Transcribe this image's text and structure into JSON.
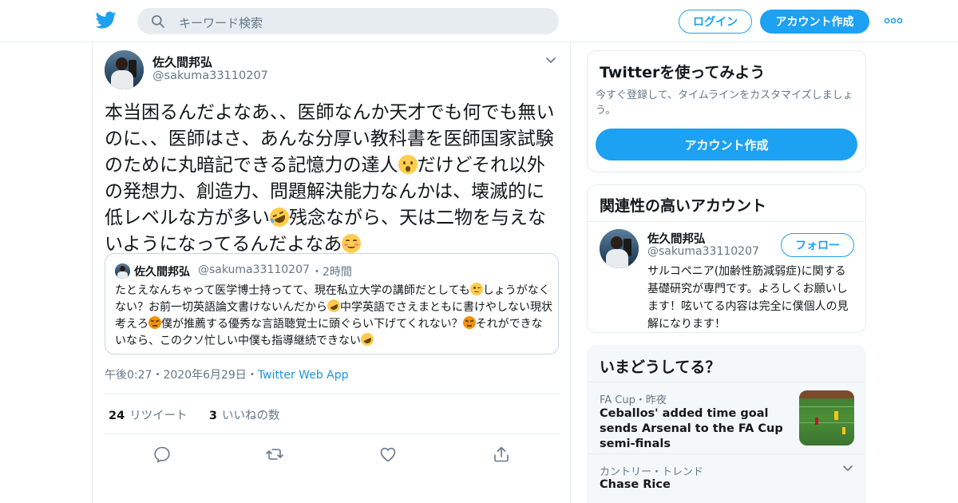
{
  "header": {
    "search_placeholder": "キーワード検索",
    "login_label": "ログイン",
    "signup_label": "アカウント作成",
    "accent": "#1da1f2"
  },
  "tweet": {
    "author_name": "佐久間邦弘",
    "author_handle": "@sakuma33110207",
    "text_parts": [
      "本当困るんだよなあ、、医師なんか天才でも何でも無いのに、、医師はさ、あんな分厚い教科書を医師国家試験のために丸暗記できる記憶力の達人",
      "だけどそれ以外の発想力、創造力、問題解決能力なんかは、壊滅的に低レベルな方が多い",
      "残念ながら、天は二物を与えないようになってるんだよなあ"
    ],
    "emojis": [
      "hushed-face-emoji",
      "rofl-emoji",
      "smiling-face-emoji"
    ],
    "quote": {
      "name": "佐久間邦弘",
      "handle": "@sakuma33110207",
      "time": "2時間",
      "parts": [
        "たとえなんちゃって医学博士持ってて、現在私立大学の講師だとしても",
        "しょうがなくない？お前一切英語論文書けないんだから",
        "中学英語でさえまともに書けやしない現状考えろ",
        "僕が推薦する優秀な言語聴覚士に頭ぐらい下げてくれない？",
        "それができないなら、このクソ忙しい中僕も指導継続できない"
      ]
    },
    "time": "午後0:27",
    "date": "2020年6月29日",
    "source": "Twitter Web App",
    "retweets_count": "24",
    "retweets_label": "リツイート",
    "likes_count": "3",
    "likes_label": "いいねの数"
  },
  "sidebar": {
    "signup_card": {
      "title": "Twitterを使ってみよう",
      "subtitle": "今すぐ登録して、タイムラインをカスタマイズしましょう。",
      "button": "アカウント作成"
    },
    "related": {
      "title": "関連性の高いアカウント",
      "name": "佐久間邦弘",
      "handle": "@sakuma33110207",
      "follow": "フォロー",
      "bio": "サルコペニア(加齢性筋減弱症)に関する基礎研究が専門です。よろしくお願いします！呟いてる内容は完全に僕個人の見解になります！"
    },
    "trends": {
      "title": "いまどうしてる？",
      "items": [
        {
          "meta": "FA Cup・昨夜",
          "title": "Ceballos' added time goal sends Arsenal to the FA Cup semi-finals"
        },
        {
          "meta": "カントリー・トレンド",
          "title": "Chase Rice"
        }
      ]
    }
  }
}
